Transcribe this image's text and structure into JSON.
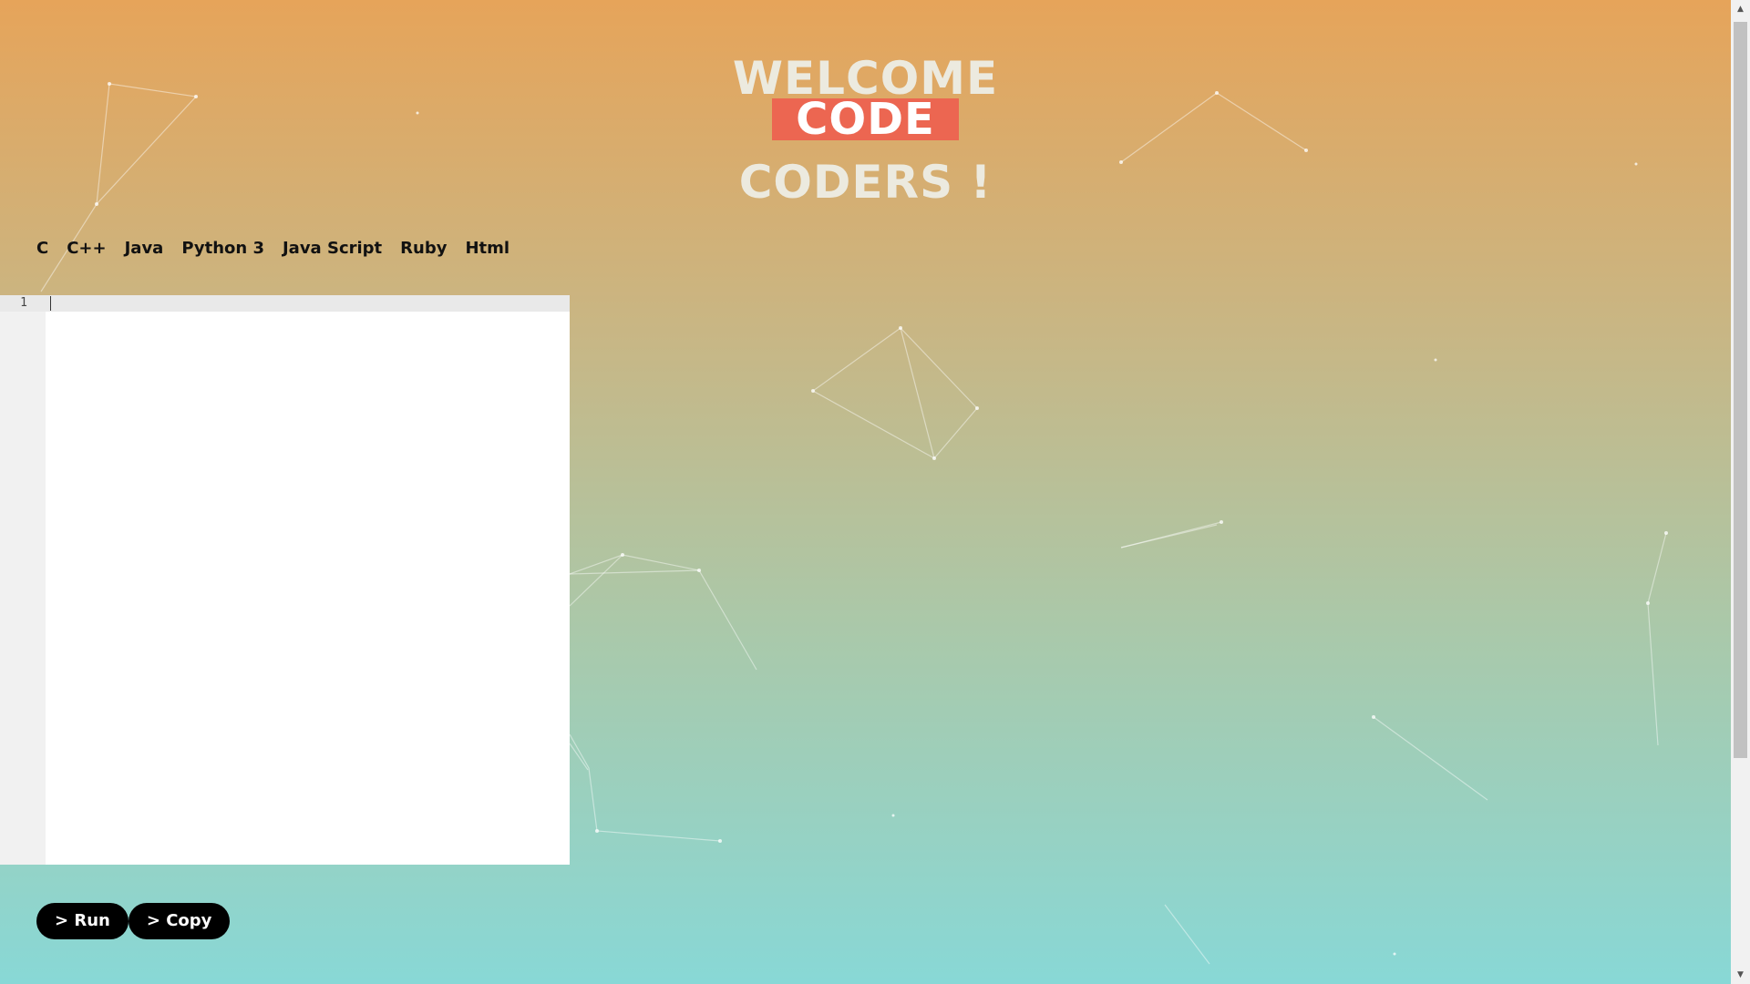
{
  "hero": {
    "welcome": "WELCOME",
    "code": "CODE",
    "coders": "CODERS !"
  },
  "languages": [
    "C",
    "C++",
    "Java",
    "Python 3",
    "Java Script",
    "Ruby",
    "Html"
  ],
  "editor": {
    "line_numbers": [
      "1"
    ],
    "content": ""
  },
  "actions": {
    "run_label": "> Run",
    "copy_label": "> Copy"
  },
  "colors": {
    "gradient_top": "#e6a45a",
    "gradient_bottom": "#88d8d6",
    "code_highlight": "#ec6651",
    "button_bg": "#000000"
  },
  "scrollbar": {
    "up_icon": "arrow-up-icon",
    "down_icon": "arrow-down-icon"
  }
}
